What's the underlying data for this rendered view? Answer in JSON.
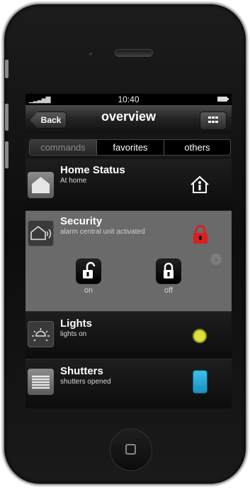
{
  "status_bar": {
    "time": "10:40",
    "signal_icon": "signal-bars-icon",
    "battery_icon": "battery-icon"
  },
  "nav": {
    "back_label": "Back",
    "title": "overview",
    "menu_icon": "grid-icon"
  },
  "tabs": [
    {
      "label": "commands",
      "active": true
    },
    {
      "label": "favorites",
      "active": false
    },
    {
      "label": "others",
      "active": false
    }
  ],
  "rows": {
    "home_status": {
      "title": "Home Status",
      "subtitle": "At home",
      "icon": "house-icon",
      "status_icon": "house-person-icon"
    },
    "security": {
      "title": "Security",
      "subtitle": "alarm central unit activated",
      "icon": "house-wifi-icon",
      "status_icon": "red-lock-icon",
      "status_color": "#d92020",
      "controls": [
        {
          "label": "on",
          "icon": "unlocked-icon"
        },
        {
          "label": "off",
          "icon": "locked-icon"
        }
      ]
    },
    "lights": {
      "title": "Lights",
      "subtitle": "lights on",
      "icon": "lamp-icon",
      "status_color": "#dde236"
    },
    "shutters": {
      "title": "Shutters",
      "subtitle": "shutters opened",
      "icon": "shutter-icon",
      "status_color": "#1ea5d9"
    }
  },
  "colors": {
    "accent_blue": "#1ea5d9",
    "light_yellow": "#dde236",
    "alarm_red": "#d92020"
  }
}
